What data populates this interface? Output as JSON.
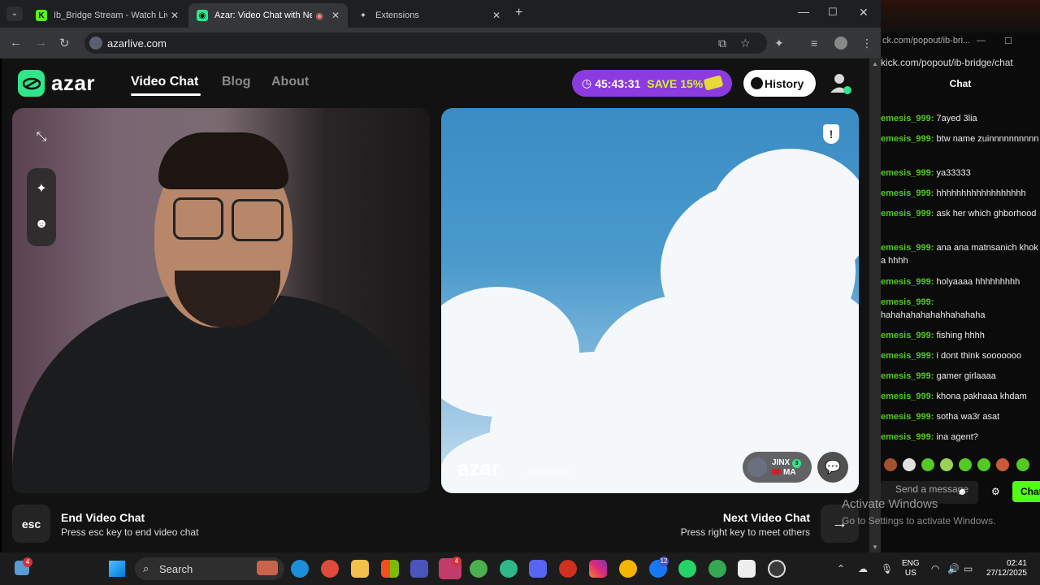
{
  "browser": {
    "tabs": [
      {
        "label": "Ib_Bridge Stream - Watch Live o",
        "active": false
      },
      {
        "label": "Azar: Video Chat with New",
        "active": true
      },
      {
        "label": "Extensions",
        "active": false
      }
    ],
    "url": "azarlive.com"
  },
  "azar": {
    "logo_text": "azar",
    "nav": [
      "Video Chat",
      "Blog",
      "About"
    ],
    "promo": {
      "timer": "45:43:31",
      "save": "SAVE 15%"
    },
    "history_label": "History",
    "remote": {
      "watermark": "azar",
      "id_text": "PeM88785y8",
      "peer_name": "JINX",
      "peer_country": "MA",
      "peer_badge": "3"
    },
    "end": {
      "key": "esc",
      "title": "End Video Chat",
      "subtitle": "Press esc key to end video chat"
    },
    "next": {
      "title": "Next Video Chat",
      "subtitle": "Press right key to meet others"
    }
  },
  "kick": {
    "window_title": "ck.com/popout/ib-bri...",
    "url": "kick.com/popout/ib-bridge/chat",
    "header": "Chat",
    "messages": [
      {
        "user": "emesis_999:",
        "text": "7ayed 3lia"
      },
      {
        "user": "emesis_999:",
        "text": "btw name zuinnnnnnnnnn"
      },
      {
        "user": "emesis_999:",
        "text": "ya33333"
      },
      {
        "user": "emesis_999:",
        "text": "hhhhhhhhhhhhhhhhhh"
      },
      {
        "user": "emesis_999:",
        "text": "ask her which ghborhood"
      },
      {
        "user": "emesis_999:",
        "text": "ana ana matnsanich khok a hhhh"
      },
      {
        "user": "emesis_999:",
        "text": "holyaaaa hhhhhhhhh"
      },
      {
        "user": "emesis_999:",
        "text": "hahahahahahahhahahaha"
      },
      {
        "user": "emesis_999:",
        "text": "fishing hhhh"
      },
      {
        "user": "emesis_999:",
        "text": "i dont think sooooooo"
      },
      {
        "user": "emesis_999:",
        "text": "gamer girlaaaa"
      },
      {
        "user": "emesis_999:",
        "text": "khona pakhaaa khdam"
      },
      {
        "user": "emesis_999:",
        "text": "sotha wa3r asat"
      },
      {
        "user": "emesis_999:",
        "text": "ina agent?"
      }
    ],
    "input_placeholder": "Send a message",
    "send_label": "Chat"
  },
  "watermark": {
    "line1": "Activate Windows",
    "line2": "Go to Settings to activate Windows."
  },
  "taskbar": {
    "search_label": "Search",
    "lang": "ENG",
    "region": "US",
    "time": "02:41",
    "date": "27/12/2025",
    "notif_badge": "4",
    "app_badge": "4",
    "fb_badge": "12"
  },
  "colors": {
    "azar_green": "#30e68a",
    "promo_purple": "#8b3be0",
    "kick_green": "#53fc18"
  }
}
